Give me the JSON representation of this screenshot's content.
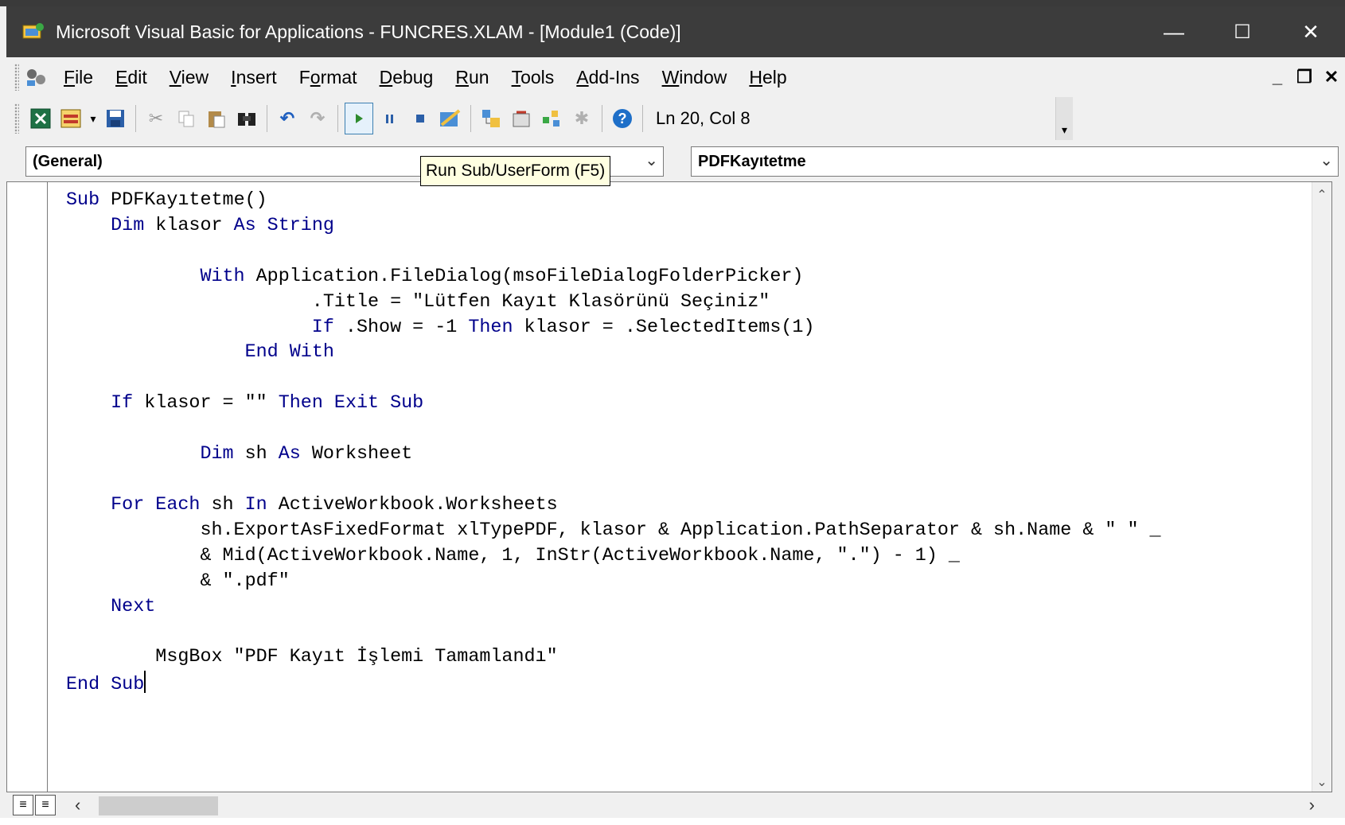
{
  "window": {
    "title": "Microsoft Visual Basic for Applications - FUNCRES.XLAM - [Module1 (Code)]",
    "controls": {
      "minimize": "—",
      "maximize": "☐",
      "close": "✕"
    }
  },
  "menu": {
    "items": [
      {
        "pre": "",
        "accel": "F",
        "post": "ile"
      },
      {
        "pre": "",
        "accel": "E",
        "post": "dit"
      },
      {
        "pre": "",
        "accel": "V",
        "post": "iew"
      },
      {
        "pre": "",
        "accel": "I",
        "post": "nsert"
      },
      {
        "pre": "F",
        "accel": "o",
        "post": "rmat"
      },
      {
        "pre": "",
        "accel": "D",
        "post": "ebug"
      },
      {
        "pre": "",
        "accel": "R",
        "post": "un"
      },
      {
        "pre": "",
        "accel": "T",
        "post": "ools"
      },
      {
        "pre": "",
        "accel": "A",
        "post": "dd-Ins"
      },
      {
        "pre": "",
        "accel": "W",
        "post": "indow"
      },
      {
        "pre": "",
        "accel": "H",
        "post": "elp"
      }
    ],
    "mdi_controls": {
      "minimize": "_",
      "restore": "🗗",
      "close": "✕"
    }
  },
  "toolbar": {
    "status": "Ln 20, Col 8",
    "tooltip": "Run Sub/UserForm (F5)",
    "icons": [
      "excel-view-icon",
      "insert-userform-icon",
      "save-icon",
      "cut-icon",
      "copy-icon",
      "paste-icon",
      "find-icon",
      "undo-icon",
      "redo-icon",
      "run-icon",
      "break-icon",
      "reset-icon",
      "design-mode-icon",
      "project-explorer-icon",
      "properties-icon",
      "object-browser-icon",
      "toolbox-icon",
      "help-icon"
    ],
    "colors": {
      "run": "#2e8b2e",
      "accent": "#3c7fb1",
      "help": "#1e6fc8"
    }
  },
  "combos": {
    "object": "(General)",
    "procedure": "PDFKayıtetme"
  },
  "code": {
    "keyword_color": "#00008b",
    "lines": [
      [
        [
          "Sub",
          "k"
        ],
        [
          " PDFKayıtetme()",
          ""
        ]
      ],
      [
        [
          "    Dim",
          "k"
        ],
        [
          " klasor ",
          ""
        ],
        [
          "As String",
          "k"
        ]
      ],
      [],
      [
        [
          "            With",
          "k"
        ],
        [
          " Application.FileDialog(msoFileDialogFolderPicker)",
          ""
        ]
      ],
      [
        [
          "                      .Title = \"Lütfen Kayıt Klasörünü Seçiniz\"",
          ""
        ]
      ],
      [
        [
          "                      If",
          "k"
        ],
        [
          " .Show = -1 ",
          ""
        ],
        [
          "Then",
          "k"
        ],
        [
          " klasor = .SelectedItems(1)",
          ""
        ]
      ],
      [
        [
          "                ",
          ""
        ],
        [
          "End With",
          "k"
        ]
      ],
      [],
      [
        [
          "    If",
          "k"
        ],
        [
          " klasor = \"\" ",
          ""
        ],
        [
          "Then Exit Sub",
          "k"
        ]
      ],
      [],
      [
        [
          "            Dim",
          "k"
        ],
        [
          " sh ",
          ""
        ],
        [
          "As",
          "k"
        ],
        [
          " Worksheet",
          ""
        ]
      ],
      [],
      [
        [
          "    For Each",
          "k"
        ],
        [
          " sh ",
          ""
        ],
        [
          "In",
          "k"
        ],
        [
          " ActiveWorkbook.Worksheets",
          ""
        ]
      ],
      [
        [
          "            sh.ExportAsFixedFormat xlTypePDF, klasor & Application.PathSeparator & sh.Name & \" \" _",
          ""
        ]
      ],
      [
        [
          "            & Mid(ActiveWorkbook.Name, 1, InStr(ActiveWorkbook.Name, \".\") - 1) _",
          ""
        ]
      ],
      [
        [
          "            & \".pdf\"",
          ""
        ]
      ],
      [
        [
          "    Next",
          "k"
        ]
      ],
      [],
      [
        [
          "        MsgBox \"PDF Kayıt İşlemi Tamamlandı\"",
          ""
        ]
      ],
      [
        [
          "End Sub",
          "k"
        ]
      ]
    ],
    "caret_line": 19
  }
}
